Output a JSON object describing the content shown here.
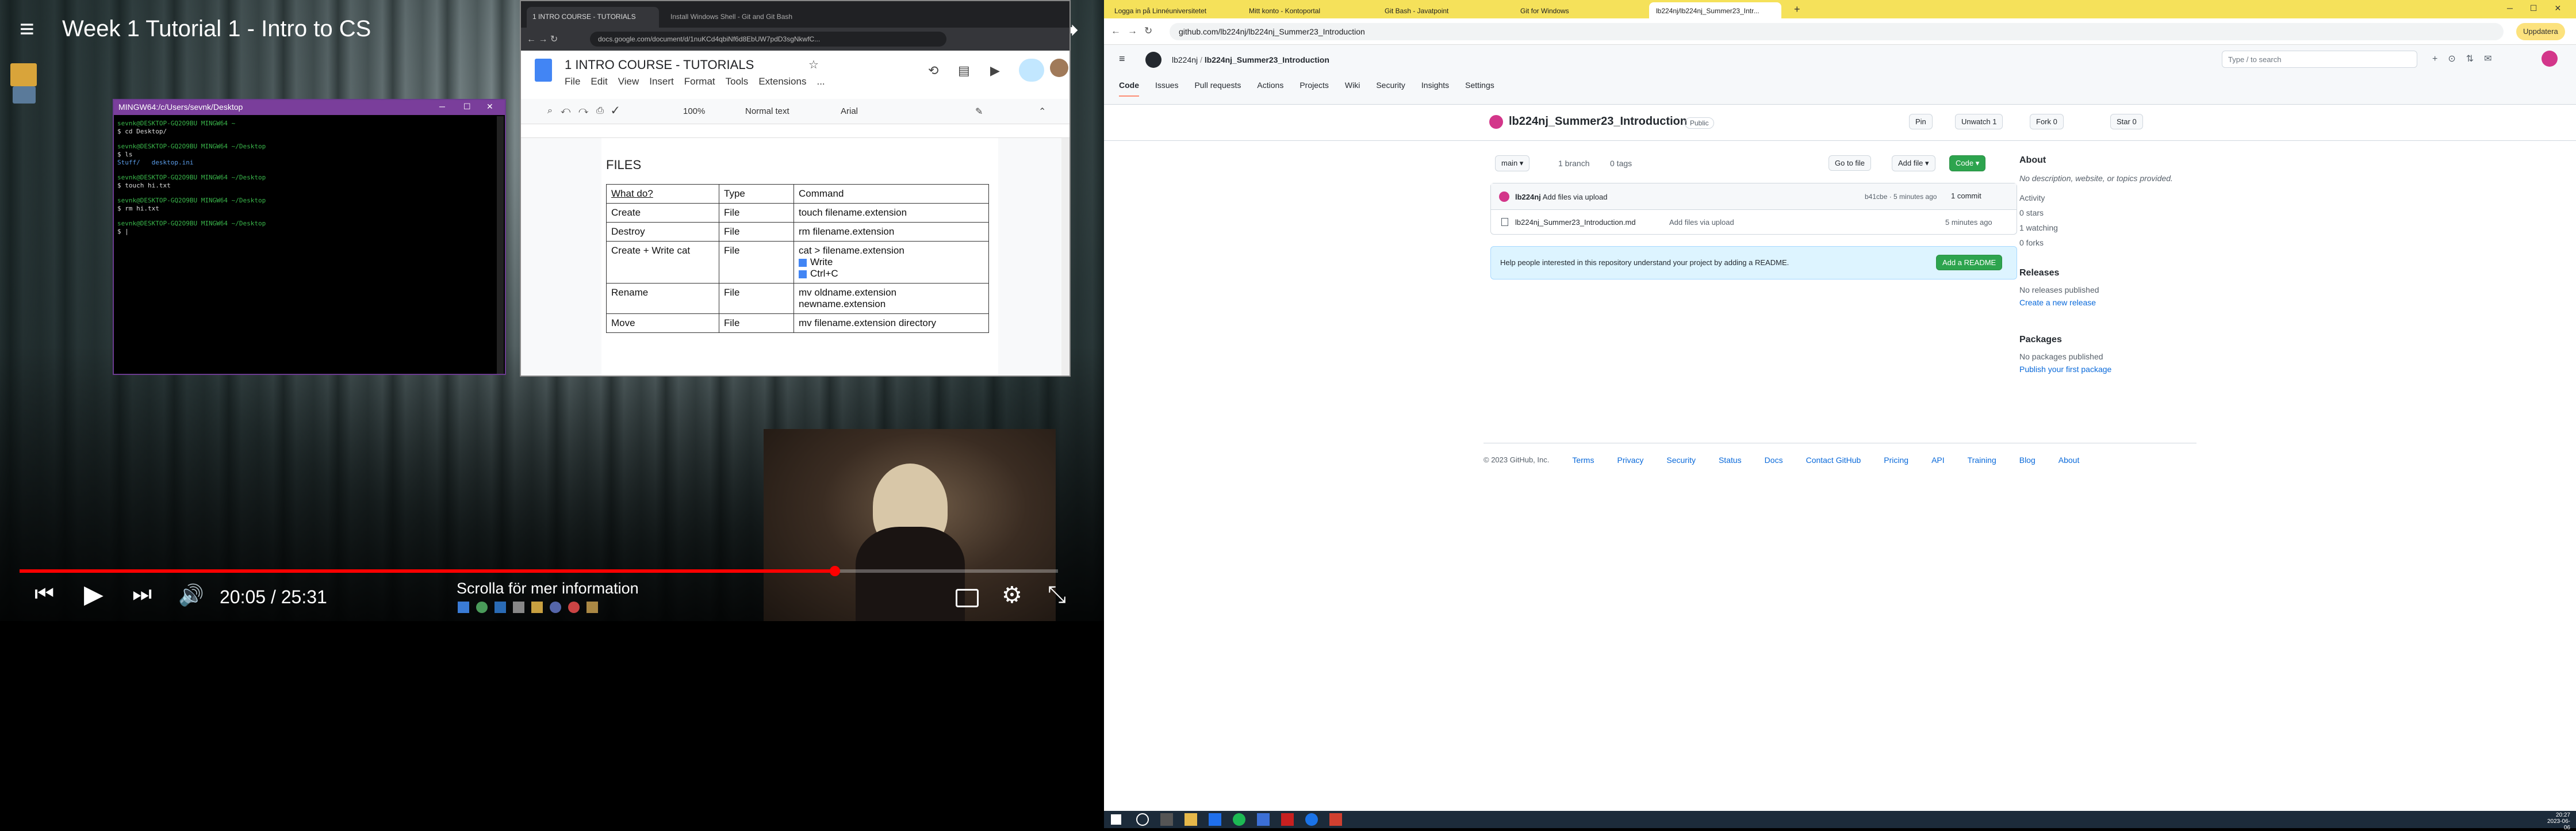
{
  "video": {
    "title": "Week 1 Tutorial 1 - Intro to CS",
    "time": "20:05 / 25:31",
    "scroll_hint": "Scrolla för mer information",
    "progress": 0.785
  },
  "desktop": {
    "icon1_label": "Skrivbord",
    "icon2_label": "Papperskorg"
  },
  "terminal": {
    "title": "MINGW64:/c/Users/sevnk/Desktop",
    "lines": [
      {
        "prompt": "sevnk@DESKTOP-GQ2O9BU MINGW64 ~",
        "cmd": "$ cd Desktop/"
      },
      {
        "prompt": "sevnk@DESKTOP-GQ2O9BU MINGW64 ~/Desktop",
        "cmd": "$ ls"
      },
      {
        "prompt": "",
        "cmd": "Stuff/   desktop.ini"
      },
      {
        "prompt": "sevnk@DESKTOP-GQ2O9BU MINGW64 ~/Desktop",
        "cmd": "$ touch hi.txt"
      },
      {
        "prompt": "sevnk@DESKTOP-GQ2O9BU MINGW64 ~/Desktop",
        "cmd": "$ rm hi.txt"
      },
      {
        "prompt": "sevnk@DESKTOP-GQ2O9BU MINGW64 ~/Desktop",
        "cmd": "$ |"
      }
    ]
  },
  "docs": {
    "tab1": "1 INTRO COURSE - TUTORIALS",
    "tab2": "Install Windows Shell - Git and Git Bash",
    "url": "docs.google.com/document/d/1nuKCd4qbiNf6d8EbUW7pdD3sgNkwfC...",
    "doc_title": "1 INTRO COURSE - TUTORIALS",
    "menu": [
      "File",
      "Edit",
      "View",
      "Insert",
      "Format",
      "Tools",
      "Extensions",
      "..."
    ],
    "zoom": "100%",
    "style": "Normal text",
    "font": "Arial",
    "heading": "FILES",
    "table": {
      "headers": [
        "What do?",
        "Type",
        "Command"
      ],
      "rows": [
        [
          "Create",
          "File",
          "touch filename.extension"
        ],
        [
          "Destroy",
          "File",
          "rm  filename.extension"
        ],
        [
          "Create + Write cat",
          "File",
          "cat > filename.extension"
        ],
        [
          "Rename",
          "File",
          "mv oldname.extension newname.extension"
        ],
        [
          "Move",
          "File",
          "mv filename.extension directory"
        ]
      ],
      "extra_write": "Write",
      "extra_ctrl": "Ctrl+C"
    }
  },
  "browser": {
    "tabs": [
      "Logga in på Linnéuniversitetet",
      "Mitt konto - Kontoportal",
      "Git Bash - Javatpoint",
      "Git for Windows",
      "lb224nj/lb224nj_Summer23_Intr..."
    ],
    "url": "github.com/lb224nj/lb224nj_Summer23_Introduction",
    "update_button": "Uppdatera"
  },
  "github": {
    "owner": "lb224nj",
    "repo": "lb224nj_Summer23_Introduction",
    "search_placeholder": "Type / to search",
    "nav": [
      "Code",
      "Issues",
      "Pull requests",
      "Actions",
      "Projects",
      "Wiki",
      "Security",
      "Insights",
      "Settings"
    ],
    "visibility": "Public",
    "pin": "Pin",
    "unwatch": "Unwatch",
    "unwatch_count": "1",
    "fork": "Fork",
    "fork_count": "0",
    "star": "Star",
    "star_count": "0",
    "branch": "main",
    "branches": "1 branch",
    "tags": "0 tags",
    "goto_file": "Go to file",
    "add_file": "Add file",
    "code_button": "Code",
    "commit_user": "lb224nj",
    "commit_msg": "Add files via upload",
    "commit_hash": "b41cbe",
    "commit_time": "5 minutes ago",
    "commit_count": "1 commit",
    "file_name": "lb224nj_Summer23_Introduction.md",
    "file_msg": "Add files via upload",
    "file_time": "5 minutes ago",
    "readme_prompt": "Help people interested in this repository understand your project by adding a README.",
    "add_readme": "Add a README",
    "about_title": "About",
    "about_desc": "No description, website, or topics provided.",
    "about_activity": "Activity",
    "about_stars": "0 stars",
    "about_watching": "1 watching",
    "about_forks": "0 forks",
    "releases_title": "Releases",
    "releases_none": "No releases published",
    "releases_link": "Create a new release",
    "packages_title": "Packages",
    "packages_none": "No packages published",
    "packages_link": "Publish your first package",
    "footer": [
      "© 2023 GitHub, Inc.",
      "Terms",
      "Privacy",
      "Security",
      "Status",
      "Docs",
      "Contact GitHub",
      "Pricing",
      "API",
      "Training",
      "Blog",
      "About"
    ]
  },
  "taskbar": {
    "time": "20:27",
    "date": "2023-06-06"
  }
}
